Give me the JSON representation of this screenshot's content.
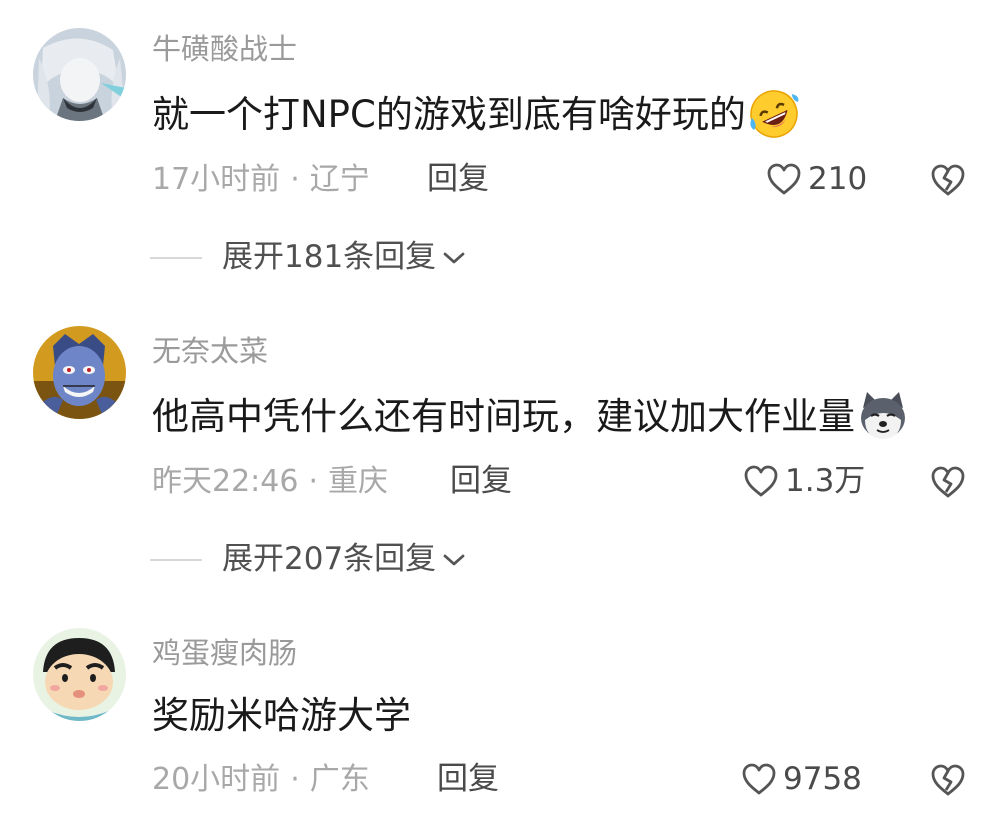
{
  "comments": [
    {
      "username": "牛磺酸战士",
      "text": "就一个打NPC的游戏到底有啥好玩的",
      "emoji": "rolling-on-floor-laughing-emoji",
      "time": "17小时前",
      "location": "辽宁",
      "reply_label": "回复",
      "likes": "210",
      "expand_label": "展开181条回复"
    },
    {
      "username": "无奈太菜",
      "text": "他高中凭什么还有时间玩，建议加大作业量",
      "emoji": "doge-emoji",
      "time": "昨天22:46",
      "location": "重庆",
      "reply_label": "回复",
      "likes": "1.3万",
      "expand_label": "展开207条回复"
    },
    {
      "username": "鸡蛋瘦肉肠",
      "text": "奖励米哈游大学",
      "time": "20小时前",
      "location": "广东",
      "reply_label": "回复",
      "likes": "9758"
    }
  ],
  "meta_separator": "·",
  "colors": {
    "username": "#9a9a9a",
    "text": "#1a1a1a",
    "meta": "#a8a8a8",
    "action": "#4a4a4a"
  }
}
